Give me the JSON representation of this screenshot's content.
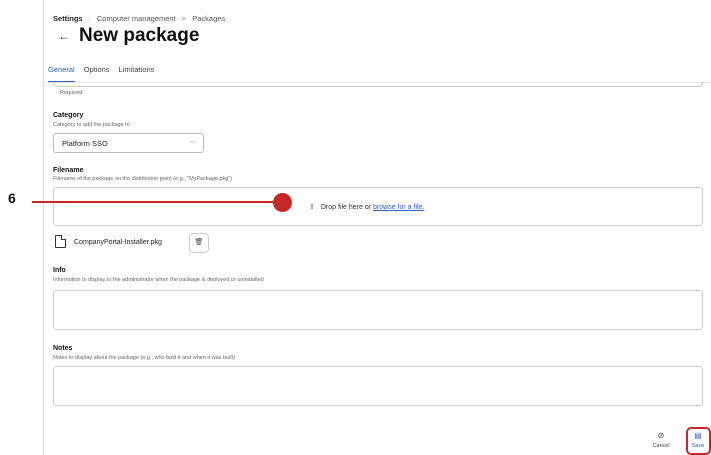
{
  "breadcrumb": {
    "root": "Settings",
    "sep1": ":",
    "middle": "Computer management",
    "sep2": ">",
    "current": "Packages"
  },
  "header": {
    "back_icon": "arrow-left-icon",
    "title": "New package"
  },
  "tabs": [
    {
      "label": "General",
      "active": true
    },
    {
      "label": "Options",
      "active": false
    },
    {
      "label": "Limitations",
      "active": false
    }
  ],
  "form": {
    "required_text": "Required",
    "category": {
      "label": "Category",
      "hint": "Category to add the package to",
      "value": "Platform SSO"
    },
    "filename": {
      "label": "Filename",
      "hint": "Filename of the package on the distribution point (e.g., \"MyPackage.pkg\")",
      "drop_text": "Drop file here or",
      "browse_link": "browse for a file.",
      "uploaded_file": "CompanyPortal-Installer.pkg"
    },
    "info": {
      "label": "Info",
      "hint": "Information to display to the administrator when the package is deployed or uninstalled"
    },
    "notes": {
      "label": "Notes",
      "hint": "Notes to display about the package (e.g., who built it and when it was built)"
    }
  },
  "footer": {
    "cancel_label": "Cancel",
    "save_label": "Save"
  },
  "callout": {
    "number": "6",
    "color": "#c62828"
  },
  "colors": {
    "accent": "#2a63c7",
    "highlight": "#c62828"
  }
}
